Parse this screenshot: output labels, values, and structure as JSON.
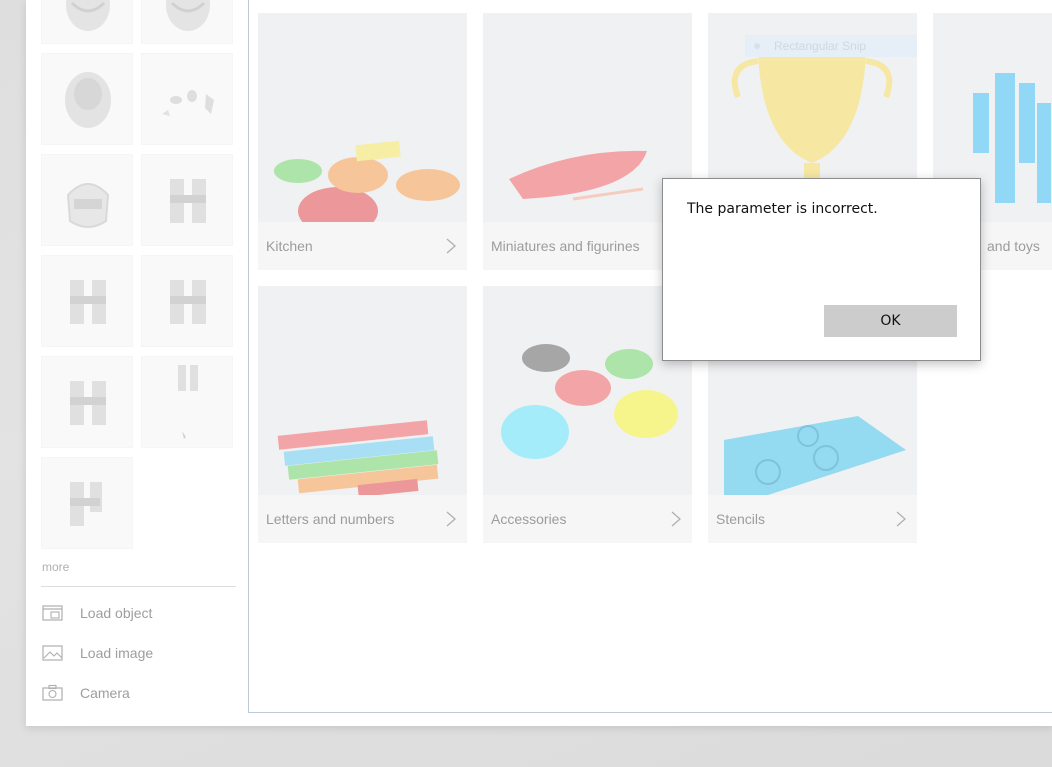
{
  "sidebar": {
    "thumbnail_icons": [
      "helmet-icon",
      "helmet-icon",
      "helmet-icon",
      "helmet-parts-icon",
      "helmet-icon",
      "helmet-parts-icon",
      "helmet-parts-icon",
      "helmet-parts-icon",
      "helmet-parts-icon",
      "helmet-parts-icon",
      "helmet-parts-icon"
    ],
    "more_label": "more",
    "actions": [
      {
        "label": "Load object",
        "icon": "load-object-icon"
      },
      {
        "label": "Load image",
        "icon": "image-icon"
      },
      {
        "label": "Camera",
        "icon": "camera-icon"
      }
    ]
  },
  "categories": [
    {
      "label": "Kitchen"
    },
    {
      "label": "Miniatures and figurines"
    },
    {
      "label": ""
    },
    {
      "label": "and toys"
    },
    {
      "label": "Letters and numbers"
    },
    {
      "label": "Accessories"
    },
    {
      "label": "Stencils"
    }
  ],
  "snip": {
    "label": "Rectangular Snip"
  },
  "dialog": {
    "message": "The parameter is incorrect.",
    "ok_label": "OK"
  },
  "colors": {
    "panel_border": "#9fb4c8",
    "tile_background": "#f2f2f2",
    "button_gray": "#cccccc"
  }
}
